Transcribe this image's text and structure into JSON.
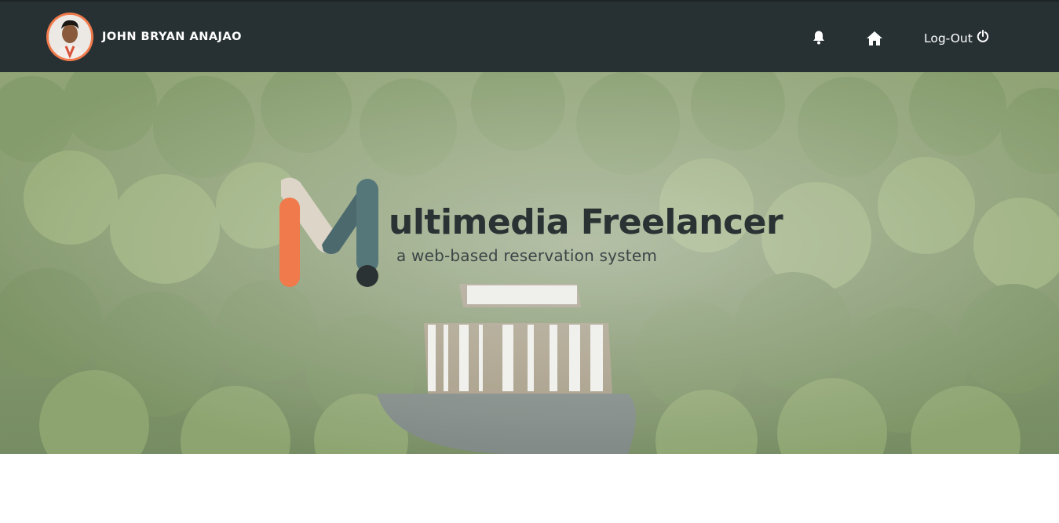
{
  "header": {
    "user_name": "JOHN BRYAN ANAJAO",
    "notifications_icon": "bell-icon",
    "home_icon": "home-icon",
    "logout_label": "Log-Out",
    "logout_icon": "power-icon"
  },
  "hero": {
    "background": "forest-waterfall-aerial",
    "logo_title": "ultimedia Freelancer",
    "logo_subtitle": "a web-based reservation system"
  },
  "colors": {
    "navbar": "#273133",
    "accent_orange": "#f07a4b",
    "logo_teal": "#4c6a6d",
    "logo_beige": "#ddd5c8",
    "logo_dark": "#2b3234"
  }
}
